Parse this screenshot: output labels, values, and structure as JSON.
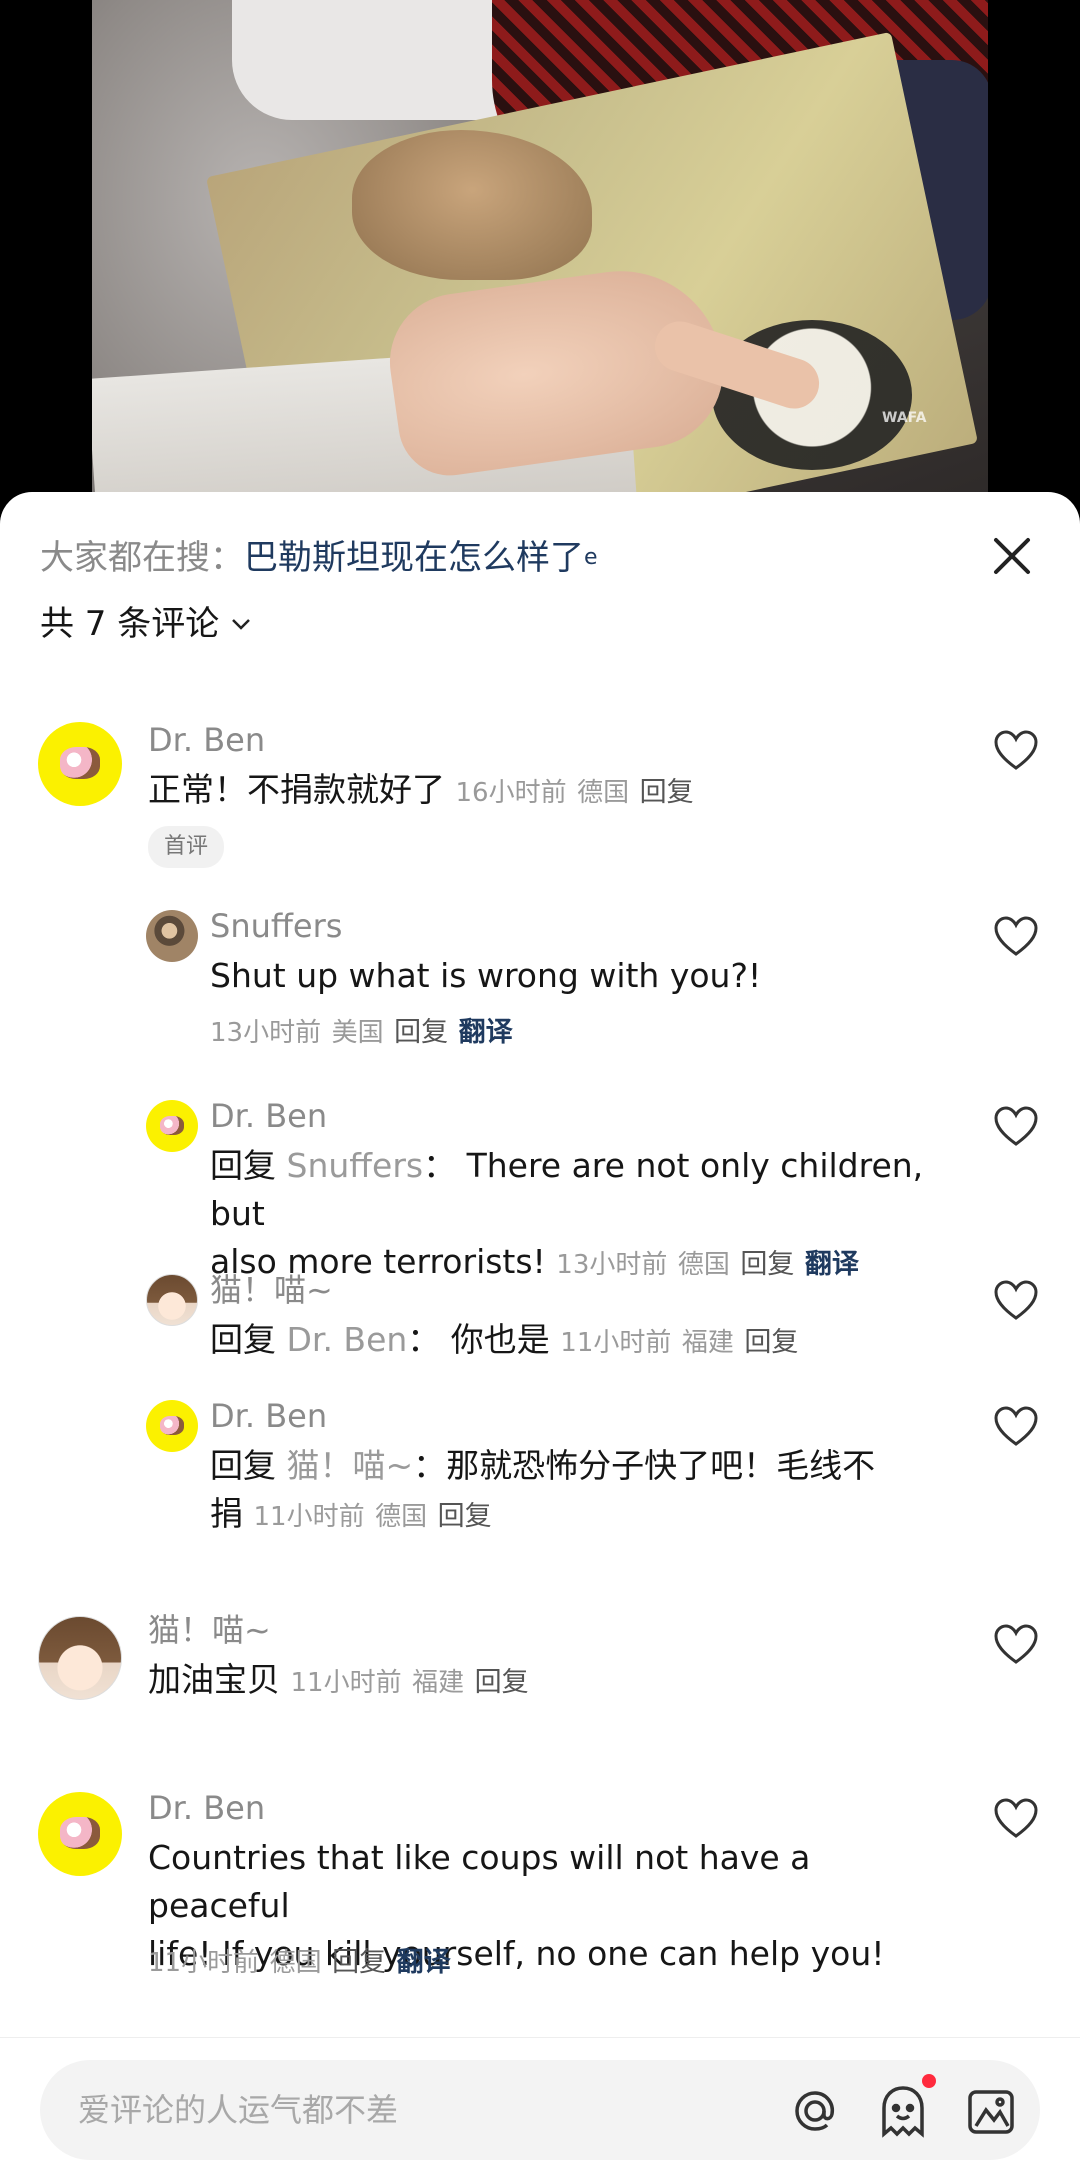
{
  "search_hint": {
    "prefix": "大家都在搜：",
    "query": "巴勒斯坦现在怎么样了",
    "icon": "search-icon"
  },
  "comment_count": {
    "label": "共 7 条评论"
  },
  "comments": [
    {
      "name": "Dr. Ben",
      "text": "正常！不捐款就好了",
      "time": "16小时前",
      "location": "德国",
      "reply": "回复",
      "badge": "首评",
      "replies": [
        {
          "name": "Snuffers",
          "text": "Shut up what is wrong with you?!",
          "time": "13小时前",
          "location": "美国",
          "reply": "回复",
          "translate": "翻译"
        },
        {
          "name": "Dr. Ben",
          "reply_prefix": "回复",
          "reply_to": "Snuffers",
          "colon": "：",
          "text_line1": "There are not only children, but",
          "text_line2": "also more terrorists!",
          "time": "13小时前",
          "location": "德国",
          "reply": "回复",
          "translate": "翻译"
        },
        {
          "name": "猫！喵~",
          "reply_prefix": "回复",
          "reply_to": "Dr. Ben",
          "colon": "：",
          "text": "你也是",
          "time": "11小时前",
          "location": "福建",
          "reply": "回复"
        },
        {
          "name": "Dr. Ben",
          "reply_prefix": "回复",
          "reply_to": "猫！喵~",
          "colon": "：",
          "text_line1": "那就恐怖分子快了吧！毛线不",
          "text_line2": "捐",
          "time": "11小时前",
          "location": "德国",
          "reply": "回复"
        }
      ]
    },
    {
      "name": "猫！喵~",
      "text": "加油宝贝",
      "time": "11小时前",
      "location": "福建",
      "reply": "回复"
    },
    {
      "name": "Dr. Ben",
      "text_line1": "Countries that like coups will not have a peaceful",
      "text_line2": "life! If you kill yourself, no one can help you!",
      "time": "11小时前",
      "location": "德国",
      "reply": "回复",
      "translate": "翻译"
    }
  ],
  "input": {
    "placeholder": "爱评论的人运气都不差"
  },
  "video": {
    "watermark": "WAFA"
  },
  "colors": {
    "link": "#1f3a5f",
    "muted": "#8a8a8a",
    "badge_bg": "#f1f1f1",
    "notification_dot": "#ff2a3d"
  }
}
